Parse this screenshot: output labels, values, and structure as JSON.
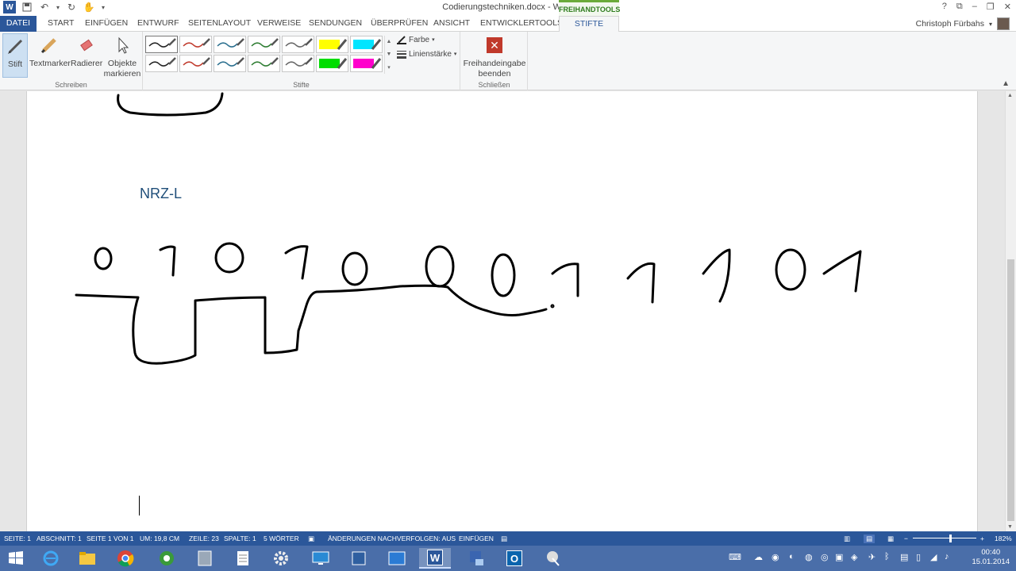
{
  "window": {
    "title": "Codierungstechniken.docx - Word",
    "contextual_group": "FREIHANDTOOLS",
    "help": "?",
    "minimize": "–",
    "restore": "❐",
    "close": "✕"
  },
  "tabs": {
    "file": "DATEI",
    "items": [
      "START",
      "EINFÜGEN",
      "ENTWURF",
      "SEITENLAYOUT",
      "VERWEISE",
      "SENDUNGEN",
      "ÜBERPRÜFEN",
      "ANSICHT",
      "ENTWICKLERTOOLS"
    ],
    "active": "STIFTE"
  },
  "user": {
    "name": "Christoph Fürbahs"
  },
  "ribbon": {
    "schreiben": {
      "label": "Schreiben",
      "stift": "Stift",
      "textmarker": "Textmarker",
      "radierer": "Radierer",
      "objekte_1": "Objekte",
      "objekte_2": "markieren"
    },
    "stifte": {
      "label": "Stifte",
      "farbe": "Farbe",
      "linienstaerke": "Linienstärke",
      "pens": [
        {
          "color": "#222222",
          "type": "pen"
        },
        {
          "color": "#c0392b",
          "type": "pen"
        },
        {
          "color": "#2a6f8f",
          "type": "pen"
        },
        {
          "color": "#2e7d32",
          "type": "pen"
        },
        {
          "color": "#666666",
          "type": "pen"
        },
        {
          "color": "#ffff00",
          "type": "marker"
        },
        {
          "color": "#00e5ff",
          "type": "marker"
        },
        {
          "color": "#222222",
          "type": "pen"
        },
        {
          "color": "#c0392b",
          "type": "pen"
        },
        {
          "color": "#2a6f8f",
          "type": "pen"
        },
        {
          "color": "#2e7d32",
          "type": "pen"
        },
        {
          "color": "#666666",
          "type": "pen"
        },
        {
          "color": "#00dd00",
          "type": "marker"
        },
        {
          "color": "#ff00cc",
          "type": "marker"
        }
      ]
    },
    "schliessen": {
      "label": "Schließen",
      "btn_1": "Freihandeingabe",
      "btn_2": "beenden"
    }
  },
  "document": {
    "heading": "NRZ-L",
    "bits": [
      "0",
      "1",
      "0",
      "1",
      "0",
      "0",
      "0",
      "1",
      "1",
      "1",
      "0",
      "1"
    ]
  },
  "status": {
    "seite": "SEITE: 1",
    "abschnitt": "ABSCHNITT: 1",
    "seite_von": "SEITE 1 VON 1",
    "um": "UM: 19,8 CM",
    "zeile": "ZEILE: 23",
    "spalte": "SPALTE: 1",
    "woerter": "5 WÖRTER",
    "aenderungen": "ÄNDERUNGEN NACHVERFOLGEN: AUS",
    "modus": "EINFÜGEN",
    "zoom": "182%",
    "zoom_minus": "−",
    "zoom_plus": "+"
  },
  "taskbar": {
    "time": "00:40",
    "date": "15.01.2014"
  }
}
